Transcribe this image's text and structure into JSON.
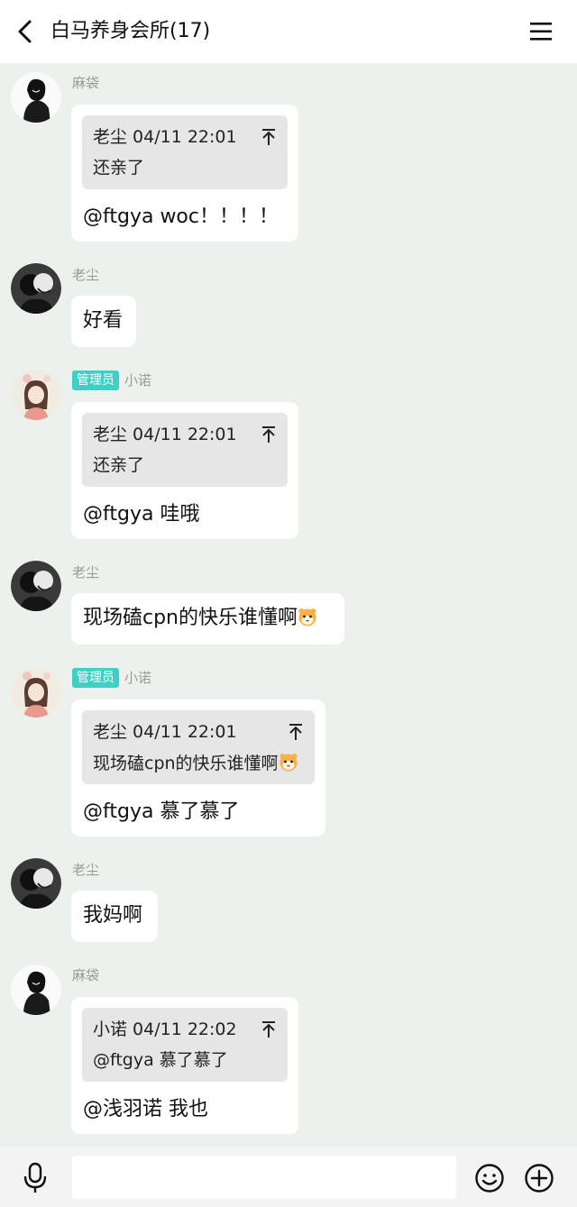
{
  "header": {
    "title": "白马养身会所(17)"
  },
  "messages": [
    {
      "sender": "麻袋",
      "badge": "",
      "avatar": "avatar-madai",
      "quote": {
        "head": "老尘 04/11 22:01",
        "text": "还亲了"
      },
      "text": "@ftgya woc！！！！"
    },
    {
      "sender": "老尘",
      "badge": "",
      "avatar": "avatar-laochen",
      "quote": null,
      "text": "好看"
    },
    {
      "sender": "小诺",
      "badge": "管理员",
      "avatar": "avatar-xiaonuo",
      "quote": {
        "head": "老尘 04/11 22:01",
        "text": "还亲了"
      },
      "text": "@ftgya 哇哦"
    },
    {
      "sender": "老尘",
      "badge": "",
      "avatar": "avatar-laochen",
      "quote": null,
      "text": "现场磕cpn的快乐谁懂啊"
    },
    {
      "sender": "小诺",
      "badge": "管理员",
      "avatar": "avatar-xiaonuo",
      "quote": {
        "head": "老尘 04/11 22:01",
        "text": "现场磕cpn的快乐谁懂啊"
      },
      "text": "@ftgya 慕了慕了"
    },
    {
      "sender": "老尘",
      "badge": "",
      "avatar": "avatar-laochen",
      "quote": null,
      "text": "我妈啊"
    },
    {
      "sender": "麻袋",
      "badge": "",
      "avatar": "avatar-madai",
      "quote": {
        "head": "小诺 04/11 22:02",
        "text": "@ftgya 慕了慕了"
      },
      "text": "@浅羽诺 我也"
    }
  ],
  "input": {
    "placeholder": ""
  },
  "icons": {
    "back": "chevron-left-icon",
    "menu": "hamburger-icon",
    "mic": "microphone-icon",
    "emoji": "smile-icon",
    "add": "plus-circle-icon",
    "quote_jump": "jump-to-top-icon",
    "hamster": "hamster-emoji"
  },
  "colors": {
    "background": "#edf1ed",
    "badge": "#3fcfc4",
    "bubble": "#ffffff",
    "quote": "#e6e6e6"
  }
}
